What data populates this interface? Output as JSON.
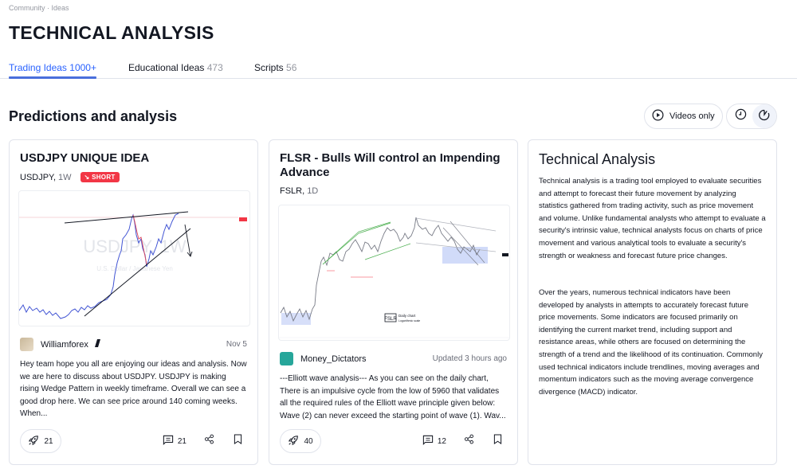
{
  "breadcrumb": "Community · Ideas",
  "page_title": "TECHNICAL ANALYSIS",
  "tabs": [
    {
      "label": "Trading Ideas",
      "count": "1000+",
      "active": true
    },
    {
      "label": "Educational Ideas",
      "count": "473",
      "active": false
    },
    {
      "label": "Scripts",
      "count": "56",
      "active": false
    }
  ],
  "section": {
    "title": "Predictions and analysis",
    "videos_only_label": "Videos only",
    "sort_options": [
      {
        "icon": "clock-icon",
        "name": "recent",
        "active": false
      },
      {
        "icon": "popular-icon",
        "name": "popular",
        "active": true
      }
    ]
  },
  "ideas": [
    {
      "title": "USDJPY UNIQUE IDEA",
      "symbol": "USDJPY,",
      "timeframe": "1W",
      "badge": "SHORT",
      "badge_color": "#f23645",
      "chart_watermark": "USDJPY, 1W",
      "chart_subtitle": "U.S. Dollar / Japanese Yen",
      "author": "Williamforex",
      "date": "Nov 5",
      "description": "Hey team hope you all are enjoying our ideas and analysis. Now we are here to discuss about USDJPY. USDJPY is making rising Wedge Pattern in weekly timeframe. Overall we can see a good drop here. We can see price around 140 coming weeks. When...",
      "boosts": "21",
      "comments": "21"
    },
    {
      "title": "FLSR - Bulls Will control an Impending Advance",
      "symbol": "FSLR,",
      "timeframe": "1D",
      "badge": "",
      "chart_label_logo": "FSLR",
      "chart_label_line1": "Daily chart",
      "chart_label_line2": "Logarithmic scale",
      "author": "Money_Dictators",
      "date": "Updated 3 hours ago",
      "description": "---Elliott wave analysis--- As you can see on the daily chart, There is an impulsive cycle from the low of 5960 that validates all the required rules of the Elliott wave principle given below: Wave (2) can never exceed the starting point of wave (1). Wav...",
      "boosts": "40",
      "comments": "12"
    }
  ],
  "info": {
    "title": "Technical Analysis",
    "paragraph1": "Technical analysis is a trading tool employed to evaluate securities and attempt to forecast their future movement by analyzing statistics gathered from trading activity, such as price movement and volume. Unlike fundamental analysts who attempt to evaluate a security's intrinsic value, technical analysts focus on charts of price movement and various analytical tools to evaluate a security's strength or weakness and forecast future price changes.",
    "paragraph2": "Over the years, numerous technical indicators have been developed by analysts in attempts to accurately forecast future price movements. Some indicators are focused primarily on identifying the current market trend, including support and resistance areas, while others are focused on determining the strength of a trend and the likelihood of its continuation. Commonly used technical indicators include trendlines, moving averages and momentum indicators such as the moving average convergence divergence (MACD) indicator."
  }
}
